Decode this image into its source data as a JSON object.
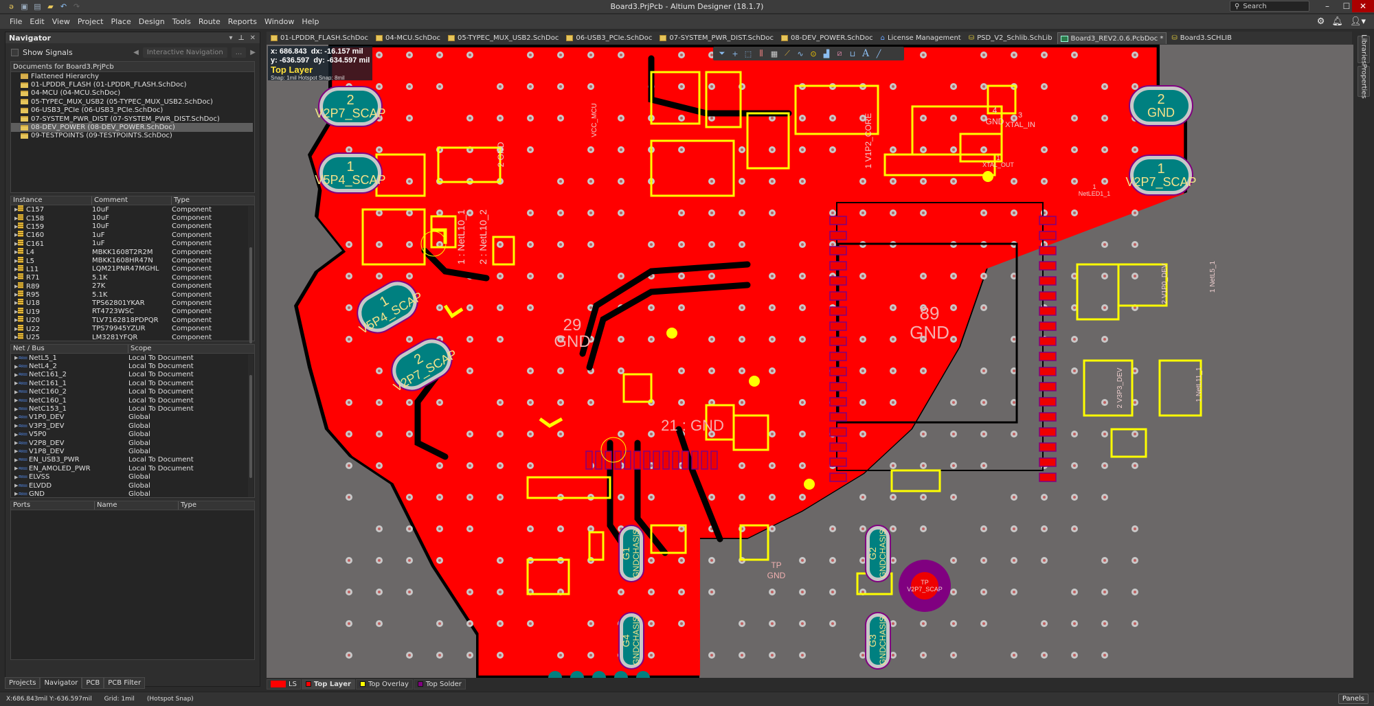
{
  "window": {
    "title": "Board3.PrjPcb - Altium Designer (18.1.7)",
    "search_placeholder": "Search",
    "minimize": "–",
    "maximize": "☐",
    "close": "✕"
  },
  "quick_access": [
    "app-logo",
    "save",
    "save-all",
    "open",
    "undo",
    "redo"
  ],
  "menu": [
    "File",
    "Edit",
    "View",
    "Project",
    "Place",
    "Design",
    "Tools",
    "Route",
    "Reports",
    "Window",
    "Help"
  ],
  "menu_right_icons": [
    "gear-icon",
    "bell-icon",
    "user-icon"
  ],
  "navigator": {
    "title": "Navigator",
    "controls": [
      "▾",
      "⊥",
      "✕"
    ],
    "show_signals_label": "Show Signals",
    "show_signals_checked": false,
    "interactive_nav_label": "Interactive Navigation",
    "more_label": "...",
    "documents_header": "Documents for Board3.PrjPcb",
    "documents": [
      {
        "label": "Flattened Hierarchy",
        "selected": false
      },
      {
        "label": "01-LPDDR_FLASH (01-LPDDR_FLASH.SchDoc)",
        "selected": false
      },
      {
        "label": "04-MCU (04-MCU.SchDoc)",
        "selected": false
      },
      {
        "label": "05-TYPEC_MUX_USB2 (05-TYPEC_MUX_USB2.SchDoc)",
        "selected": false
      },
      {
        "label": "06-USB3_PCIe (06-USB3_PCIe.SchDoc)",
        "selected": false
      },
      {
        "label": "07-SYSTEM_PWR_DIST (07-SYSTEM_PWR_DIST.SchDoc)",
        "selected": false
      },
      {
        "label": "08-DEV_POWER (08-DEV_POWER.SchDoc)",
        "selected": true
      },
      {
        "label": "09-TESTPOINTS (09-TESTPOINTS.SchDoc)",
        "selected": false
      }
    ],
    "instances": {
      "columns": [
        "Instance",
        "Comment",
        "Type"
      ],
      "rows": [
        [
          "C157",
          "10uF",
          "Component"
        ],
        [
          "C158",
          "10uF",
          "Component"
        ],
        [
          "C159",
          "10uF",
          "Component"
        ],
        [
          "C160",
          "1uF",
          "Component"
        ],
        [
          "C161",
          "1uF",
          "Component"
        ],
        [
          "L4",
          "MBKK1608T2R2M",
          "Component"
        ],
        [
          "L5",
          "MBKK1608HR47N",
          "Component"
        ],
        [
          "L11",
          "LQM21PNR47MGHL",
          "Component"
        ],
        [
          "R71",
          "5.1K",
          "Component"
        ],
        [
          "R89",
          "27K",
          "Component"
        ],
        [
          "R95",
          "5.1K",
          "Component"
        ],
        [
          "U18",
          "TPS62801YKAR",
          "Component"
        ],
        [
          "U19",
          "RT4723WSC",
          "Component"
        ],
        [
          "U20",
          "TLV7162818PDPQR",
          "Component"
        ],
        [
          "U22",
          "TPS79945YZUR",
          "Component"
        ],
        [
          "U25",
          "LM3281YFQR",
          "Component"
        ]
      ]
    },
    "nets": {
      "columns": [
        "Net / Bus",
        "Scope"
      ],
      "rows": [
        [
          "NetL5_1",
          "Local To Document"
        ],
        [
          "NetL4_2",
          "Local To Document"
        ],
        [
          "NetC161_2",
          "Local To Document"
        ],
        [
          "NetC161_1",
          "Local To Document"
        ],
        [
          "NetC160_2",
          "Local To Document"
        ],
        [
          "NetC160_1",
          "Local To Document"
        ],
        [
          "NetC153_1",
          "Local To Document"
        ],
        [
          "V1P0_DEV",
          "Global"
        ],
        [
          "V3P3_DEV",
          "Global"
        ],
        [
          "V5P0",
          "Global"
        ],
        [
          "V2P8_DEV",
          "Global"
        ],
        [
          "V1P8_DEV",
          "Global"
        ],
        [
          "EN_USB3_PWR",
          "Local To Document"
        ],
        [
          "EN_AMOLED_PWR",
          "Local To Document"
        ],
        [
          "ELVSS",
          "Global"
        ],
        [
          "ELVDD",
          "Global"
        ],
        [
          "GND",
          "Global"
        ]
      ]
    },
    "ports": {
      "columns": [
        "Ports",
        "Name",
        "Type"
      ]
    },
    "panel_tabs": [
      {
        "label": "Projects",
        "active": false
      },
      {
        "label": "Navigator",
        "active": true
      },
      {
        "label": "PCB",
        "active": false
      },
      {
        "label": "PCB Filter",
        "active": false
      }
    ]
  },
  "doc_tabs": [
    {
      "label": "01-LPDDR_FLASH.SchDoc",
      "icon": "sch",
      "active": false
    },
    {
      "label": "04-MCU.SchDoc",
      "icon": "sch",
      "active": false
    },
    {
      "label": "05-TYPEC_MUX_USB2.SchDoc",
      "icon": "sch",
      "active": false
    },
    {
      "label": "06-USB3_PCIe.SchDoc",
      "icon": "sch",
      "active": false
    },
    {
      "label": "07-SYSTEM_PWR_DIST.SchDoc",
      "icon": "sch",
      "active": false
    },
    {
      "label": "08-DEV_POWER.SchDoc",
      "icon": "sch",
      "active": false
    },
    {
      "label": "License Management",
      "icon": "home",
      "active": false
    },
    {
      "label": "PSD_V2_Schlib.SchLib",
      "icon": "lib",
      "active": false
    },
    {
      "label": "Board3_REV2.0.6.PcbDoc *",
      "icon": "pcb",
      "active": true
    },
    {
      "label": "Board3.SCHLIB",
      "icon": "lib",
      "active": false
    }
  ],
  "right_panels": [
    "Libraries",
    "Properties"
  ],
  "hud": {
    "x_label": "x:",
    "x": "686.843",
    "dx_label": "dx:",
    "dx": "-16.157",
    "y_label": "y:",
    "y": "-636.597",
    "dy_label": "dy:",
    "dy": "-634.597",
    "unit": "mil",
    "layer": "Top Layer",
    "snap": "Snap: 1mil Hotspot Snap: 8mil"
  },
  "active_bar_tools": [
    "filter",
    "crosshair",
    "select-rect",
    "align",
    "component",
    "route",
    "diff-pair",
    "via",
    "polygon",
    "keepout",
    "dimension",
    "text",
    "line"
  ],
  "pcb_labels": [
    {
      "num": "2",
      "net": "V2P7_SCAP"
    },
    {
      "num": "1",
      "net": "V5P4_SCAP"
    },
    {
      "num": "2",
      "net": "GND"
    },
    {
      "num": "1",
      "net": "V2P7_SCAP"
    },
    {
      "num": "29",
      "net": "GND"
    },
    {
      "num": "89",
      "net": "GND"
    },
    {
      "num": "21",
      "net": "GND"
    },
    {
      "num": "G1",
      "net": "GNDCHASIS"
    },
    {
      "num": "G2",
      "net": "GNDCHASIS"
    },
    {
      "num": "G3",
      "net": "GNDCHASIS"
    },
    {
      "num": "G4",
      "net": "GNDCHASIS"
    },
    {
      "num": "TP",
      "net": "V2P7_SCAP"
    },
    {
      "num": "TP",
      "net": "GND"
    },
    {
      "num": "3",
      "net": "XTAL_IN"
    },
    {
      "num": "1",
      "net": "XTAL_OUT"
    },
    {
      "num": "4",
      "net": "GND"
    },
    {
      "num": "1",
      "net": "NetLED1_1"
    },
    {
      "num": "2",
      "net": "V1P0_DEV"
    },
    {
      "num": "1",
      "net": "NetL5_1"
    },
    {
      "num": "1",
      "net": "NetL11_1"
    },
    {
      "num": "2",
      "net": "V3P3_DEV"
    },
    {
      "num": "1",
      "net": "NetL10_1"
    },
    {
      "num": "2",
      "net": "NetL10_2"
    },
    {
      "num": "1",
      "net": "V1P2_CORE"
    },
    {
      "num": "2",
      "net": "GND"
    },
    {
      "num": "",
      "net": "VCC_MCU"
    }
  ],
  "layers": [
    {
      "label": "LS",
      "color": "#ff0000",
      "active": false
    },
    {
      "label": "Top Layer",
      "color": "#ff0000",
      "active": true
    },
    {
      "label": "Top Overlay",
      "color": "#ffff00",
      "active": false
    },
    {
      "label": "Top Solder",
      "color": "#800080",
      "active": false
    }
  ],
  "status": {
    "coords": "X:686.843mil Y:-636.597mil",
    "grid": "Grid: 1mil",
    "snap": "(Hotspot Snap)",
    "panels_button": "Panels"
  },
  "colors": {
    "copper": "#ff0000",
    "overlay": "#ffff00",
    "pad_teal": "#008080",
    "solder": "#800080",
    "board_bg": "#6b6868"
  }
}
